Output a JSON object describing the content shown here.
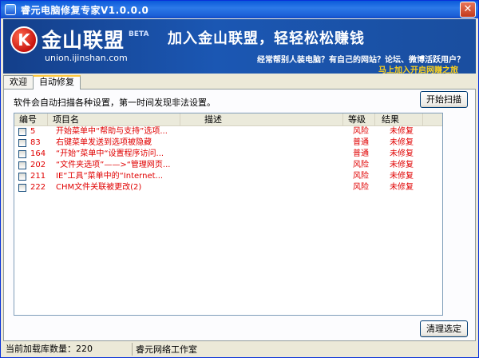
{
  "window": {
    "title": "睿元电脑修复专家V1.0.0.0",
    "close_label": "✕"
  },
  "banner": {
    "logo_letter": "K",
    "logo_text": "金山联盟",
    "beta": "BETA",
    "url": "union.ijinshan.com",
    "headline": "加入金山联盟，轻轻松松赚钱",
    "sub": "经常帮别人装电脑？有自己的网站？论坛、微博活跃用户？",
    "cta": "马上加入开启网赚之旅"
  },
  "tabs": [
    {
      "label": "欢迎"
    },
    {
      "label": "自动修复"
    }
  ],
  "panel": {
    "description": "软件会自动扫描各种设置，第一时间发现非法设置。",
    "scan_button": "开始扫描",
    "clear_button": "清理选定"
  },
  "list": {
    "headers": [
      "编号",
      "项目名",
      "描述",
      "等级",
      "结果"
    ],
    "rows": [
      {
        "id": "5",
        "name": "开始菜单中“帮助与支持”选项...",
        "desc": "",
        "level": "风险",
        "result": "未修复"
      },
      {
        "id": "83",
        "name": "右键菜单发送到选项被隐藏",
        "desc": "",
        "level": "普通",
        "result": "未修复"
      },
      {
        "id": "164",
        "name": "“开始”菜单中“设置程序访问...",
        "desc": "",
        "level": "普通",
        "result": "未修复"
      },
      {
        "id": "202",
        "name": "“文件夹选项”——>“管理网页...",
        "desc": "",
        "level": "风险",
        "result": "未修复"
      },
      {
        "id": "211",
        "name": "IE“工具”菜单中的“Internet...",
        "desc": "",
        "level": "风险",
        "result": "未修复"
      },
      {
        "id": "222",
        "name": "CHM文件关联被更改(2)",
        "desc": "",
        "level": "风险",
        "result": "未修复"
      }
    ]
  },
  "status": {
    "left": "当前加载库数量：220",
    "right": "睿元网络工作室"
  }
}
